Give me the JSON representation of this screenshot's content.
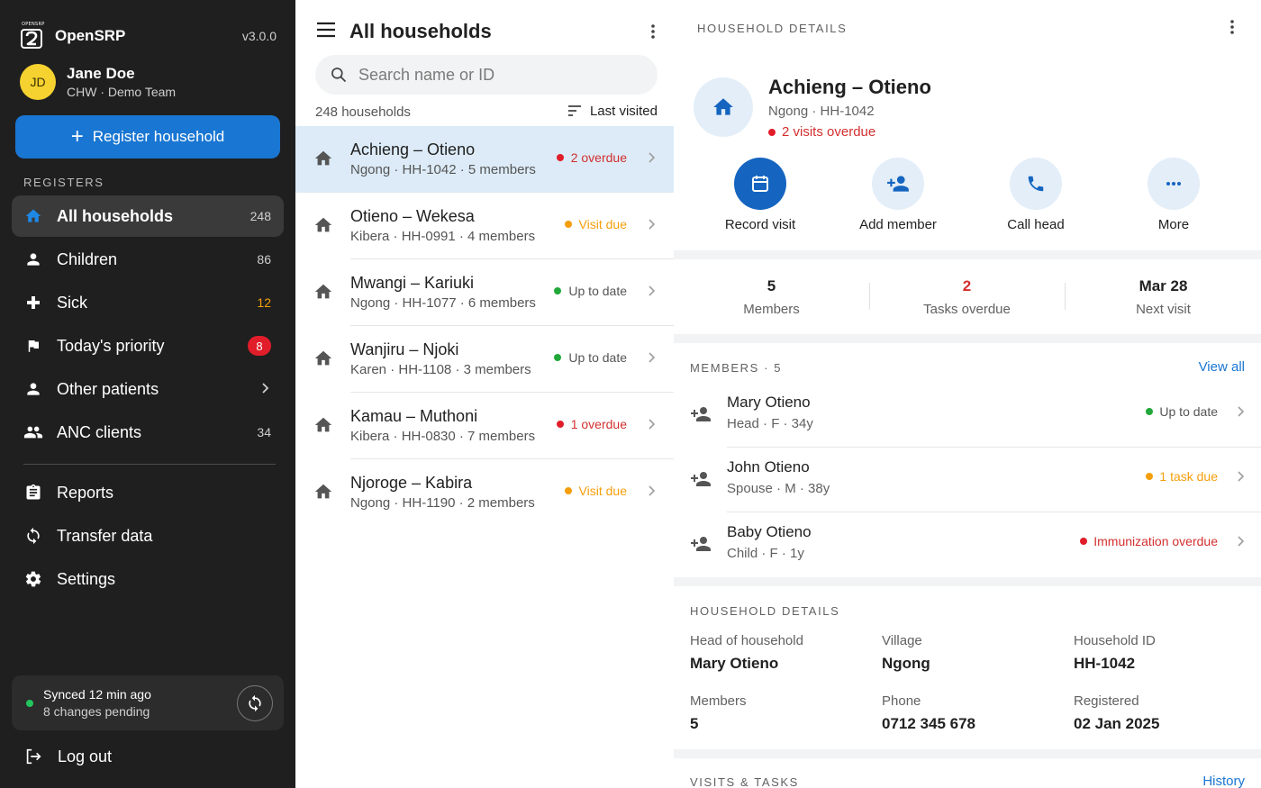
{
  "app": {
    "logo_small_text": "OPENSRP",
    "name": "OpenSRP",
    "version": "v3.0.0"
  },
  "user": {
    "initials": "JD",
    "name": "Jane Doe",
    "role": "CHW · Demo Team"
  },
  "sidebar": {
    "register_label": "Register household",
    "registers_label": "REGISTERS",
    "items": [
      {
        "label": "All households",
        "count": "248",
        "icon": "home-icon"
      },
      {
        "label": "Children",
        "count": "86",
        "icon": "person-icon"
      },
      {
        "label": "Sick",
        "count": "12",
        "icon": "plus-icon"
      },
      {
        "label": "Today's priority",
        "count": "8",
        "icon": "flag-icon"
      },
      {
        "label": "Other patients",
        "count": "",
        "icon": "person-icon"
      },
      {
        "label": "ANC clients",
        "count": "34",
        "icon": "group-icon"
      }
    ],
    "tools": [
      {
        "label": "Reports",
        "icon": "clipboard-icon"
      },
      {
        "label": "Transfer data",
        "icon": "sync-icon"
      },
      {
        "label": "Settings",
        "icon": "gear-icon"
      }
    ],
    "sync": {
      "title": "Synced 12 min ago",
      "subtitle": "8 changes pending"
    },
    "logout_label": "Log out"
  },
  "list": {
    "title": "All households",
    "search_placeholder": "Search name or ID",
    "count_label": "248 households",
    "sort_label": "Last visited",
    "households": [
      {
        "name": "Achieng – Otieno",
        "meta": "Ngong · HH-1042 · 5 members",
        "status": "2 overdue",
        "status_type": "red"
      },
      {
        "name": "Otieno – Wekesa",
        "meta": "Kibera · HH-0991 · 4 members",
        "status": "Visit due",
        "status_type": "orange"
      },
      {
        "name": "Mwangi – Kariuki",
        "meta": "Ngong · HH-1077 · 6 members",
        "status": "Up to date",
        "status_type": "green"
      },
      {
        "name": "Wanjiru – Njoki",
        "meta": "Karen · HH-1108 · 3 members",
        "status": "Up to date",
        "status_type": "green"
      },
      {
        "name": "Kamau – Muthoni",
        "meta": "Kibera · HH-0830 · 7 members",
        "status": "1 overdue",
        "status_type": "red"
      },
      {
        "name": "Njoroge – Kabira",
        "meta": "Ngong · HH-1190 · 2 members",
        "status": "Visit due",
        "status_type": "orange"
      }
    ]
  },
  "detail": {
    "section_label": "HOUSEHOLD DETAILS",
    "name": "Achieng – Otieno",
    "sub": "Ngong · HH-1042",
    "overdue": "2 visits overdue",
    "actions": [
      {
        "label": "Record visit",
        "icon": "calendar-icon"
      },
      {
        "label": "Add member",
        "icon": "person-add-icon"
      },
      {
        "label": "Call head",
        "icon": "phone-icon"
      },
      {
        "label": "More",
        "icon": "more-icon"
      }
    ],
    "stats": [
      {
        "value": "5",
        "label": "Members"
      },
      {
        "value": "2",
        "label": "Tasks overdue"
      },
      {
        "value": "Mar 28",
        "label": "Next visit"
      }
    ],
    "members_title": "MEMBERS · 5",
    "members_link": "View all",
    "members": [
      {
        "name": "Mary Otieno",
        "meta": "Head · F · 34y",
        "status": "Up to date",
        "status_type": "green"
      },
      {
        "name": "John Otieno",
        "meta": "Spouse · M · 38y",
        "status": "1 task due",
        "status_type": "orange"
      },
      {
        "name": "Baby Otieno",
        "meta": "Child · F · 1y",
        "status": "Immunization overdue",
        "status_type": "red"
      }
    ],
    "details_title": "HOUSEHOLD DETAILS",
    "fields": [
      {
        "label": "Head of household",
        "value": "Mary Otieno"
      },
      {
        "label": "Village",
        "value": "Ngong"
      },
      {
        "label": "Household ID",
        "value": "HH-1042"
      },
      {
        "label": "Members",
        "value": "5"
      },
      {
        "label": "Phone",
        "value": "0712 345 678"
      },
      {
        "label": "Registered",
        "value": "02 Jan 2025"
      }
    ],
    "visits_title": "VISITS & TASKS",
    "visits_link": "History"
  },
  "colors": {
    "sidebar_bg": "#1f1f1f",
    "primary": "#1976d2",
    "selected_row": "#dcebf7",
    "overdue_red": "#d32f2f",
    "due_orange": "#f59e0b",
    "ok_green": "#22a83a"
  }
}
